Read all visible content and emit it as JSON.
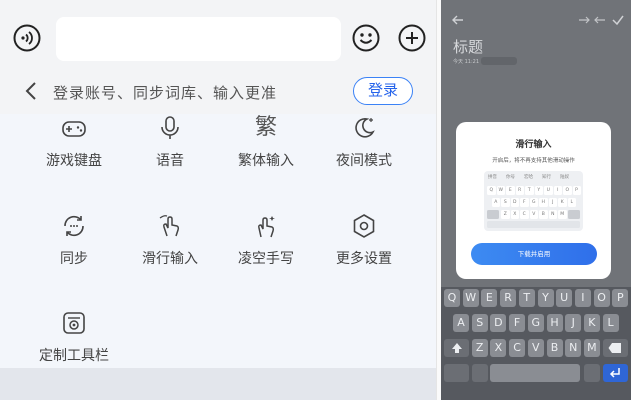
{
  "input_bar": {
    "voice_icon": "voice-icon",
    "text_value": "",
    "emoji_icon": "emoji-icon",
    "plus_icon": "plus-icon"
  },
  "login_bar": {
    "back_icon": "chevron-left-icon",
    "hint": "登录账号、同步词库、输入更准",
    "login_label": "登录",
    "accent": "#2563eb"
  },
  "tools": [
    {
      "label": "游戏键盘",
      "icon": "gamepad-icon"
    },
    {
      "label": "语音",
      "icon": "microphone-icon"
    },
    {
      "label": "繁体输入",
      "icon": "traditional-char-icon",
      "glyph": "繁"
    },
    {
      "label": "夜间模式",
      "icon": "moon-icon"
    },
    {
      "label": "同步",
      "icon": "sync-icon"
    },
    {
      "label": "滑行输入",
      "icon": "swipe-icon"
    },
    {
      "label": "凌空手写",
      "icon": "handwriting-icon"
    },
    {
      "label": "更多设置",
      "icon": "settings-hexagon-icon"
    },
    {
      "label": "定制工具栏",
      "icon": "custom-toolbar-icon"
    }
  ],
  "phone": {
    "note_title": "标题",
    "note_meta": "今天 11:21",
    "dialog": {
      "title": "滑行输入",
      "subtitle": "开启后，将不再支持其他滑动操作",
      "candidates": [
        "拼音",
        "你号",
        "宏哈",
        "知行",
        "陆奴"
      ],
      "mini_rows": [
        [
          "Q",
          "W",
          "E",
          "R",
          "T",
          "Y",
          "U",
          "I",
          "O",
          "P"
        ],
        [
          "A",
          "S",
          "D",
          "F",
          "G",
          "H",
          "J",
          "K",
          "L"
        ],
        [
          "Z",
          "X",
          "C",
          "V",
          "B",
          "N",
          "M"
        ]
      ],
      "button_label": "下载并启用"
    },
    "keyboard_rows": [
      [
        "Q",
        "W",
        "E",
        "R",
        "T",
        "Y",
        "U",
        "I",
        "O",
        "P"
      ],
      [
        "A",
        "S",
        "D",
        "F",
        "G",
        "H",
        "J",
        "K",
        "L"
      ],
      [
        "Z",
        "X",
        "C",
        "V",
        "B",
        "N",
        "M"
      ]
    ]
  }
}
